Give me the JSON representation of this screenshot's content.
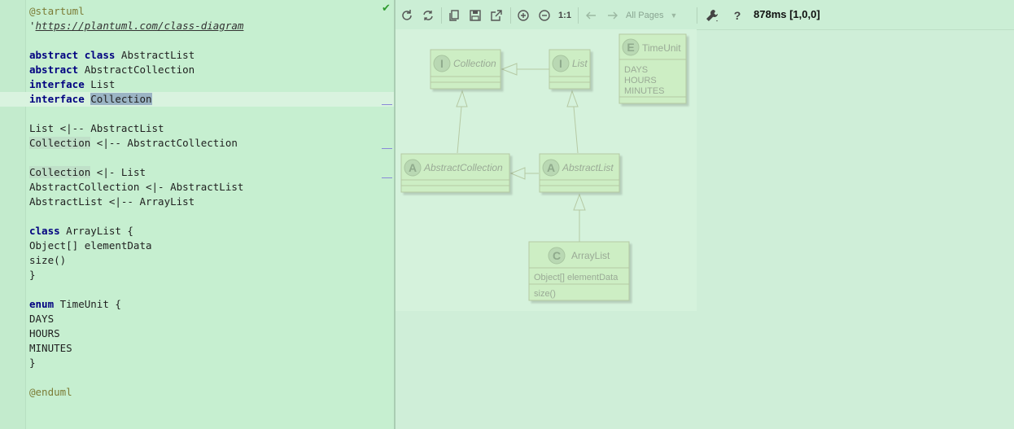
{
  "editor": {
    "lines": [
      {
        "parts": [
          {
            "t": "@startuml",
            "c": "dir"
          }
        ]
      },
      {
        "parts": [
          {
            "t": "'"
          },
          {
            "t": "https://plantuml.com/class-diagram",
            "c": "link"
          }
        ]
      },
      {
        "parts": []
      },
      {
        "parts": [
          {
            "t": "abstract",
            "c": "kw"
          },
          {
            "t": " "
          },
          {
            "t": "class",
            "c": "kw"
          },
          {
            "t": " AbstractList"
          }
        ]
      },
      {
        "parts": [
          {
            "t": "abstract",
            "c": "kw"
          },
          {
            "t": " AbstractCollection"
          }
        ]
      },
      {
        "parts": [
          {
            "t": "interface",
            "c": "kw"
          },
          {
            "t": " List"
          }
        ]
      },
      {
        "parts": [
          {
            "t": "interface",
            "c": "kw"
          },
          {
            "t": " "
          },
          {
            "t": "Collection",
            "c": "sel"
          }
        ]
      },
      {
        "parts": []
      },
      {
        "parts": [
          {
            "t": "List <|-- AbstractList"
          }
        ]
      },
      {
        "parts": [
          {
            "t": "Collection",
            "c": "hl-word"
          },
          {
            "t": " <|-- AbstractCollection"
          }
        ]
      },
      {
        "parts": []
      },
      {
        "parts": [
          {
            "t": "Collection",
            "c": "hl-word"
          },
          {
            "t": " <|- List"
          }
        ]
      },
      {
        "parts": [
          {
            "t": "AbstractCollection <|- AbstractList"
          }
        ]
      },
      {
        "parts": [
          {
            "t": "AbstractList <|-- ArrayList"
          }
        ]
      },
      {
        "parts": []
      },
      {
        "parts": [
          {
            "t": "class",
            "c": "kw"
          },
          {
            "t": " ArrayList {"
          }
        ]
      },
      {
        "parts": [
          {
            "t": "Object[] elementData"
          }
        ]
      },
      {
        "parts": [
          {
            "t": "size()"
          }
        ]
      },
      {
        "parts": [
          {
            "t": "}"
          }
        ]
      },
      {
        "parts": []
      },
      {
        "parts": [
          {
            "t": "enum",
            "c": "kw"
          },
          {
            "t": " TimeUnit {"
          }
        ]
      },
      {
        "parts": [
          {
            "t": "DAYS"
          }
        ]
      },
      {
        "parts": [
          {
            "t": "HOURS"
          }
        ]
      },
      {
        "parts": [
          {
            "t": "MINUTES"
          }
        ]
      },
      {
        "parts": [
          {
            "t": "}"
          }
        ]
      },
      {
        "parts": []
      },
      {
        "parts": [
          {
            "t": "@enduml",
            "c": "dir"
          }
        ]
      }
    ],
    "status_icon": "check-icon"
  },
  "toolbar": {
    "pages_label": "All Pages",
    "zoom_reset_label": "1:1",
    "help_label": "?",
    "timing": "878ms [1,0,0]"
  },
  "diagram": {
    "collection": {
      "stereotype": "I",
      "name": "Collection"
    },
    "list": {
      "stereotype": "I",
      "name": "List"
    },
    "timeunit": {
      "stereotype": "E",
      "name": "TimeUnit",
      "values": [
        "DAYS",
        "HOURS",
        "MINUTES"
      ]
    },
    "abstract_collection": {
      "stereotype": "A",
      "name": "AbstractCollection"
    },
    "abstract_list": {
      "stereotype": "A",
      "name": "AbstractList"
    },
    "arraylist": {
      "stereotype": "C",
      "name": "ArrayList",
      "field": "Object[] elementData",
      "method": "size()"
    }
  },
  "colors": {
    "box_fill": "#cdeec4",
    "box_stroke": "#b5c9a3",
    "text": "#9aaa96",
    "circle_fill": "#b9d8b3"
  }
}
